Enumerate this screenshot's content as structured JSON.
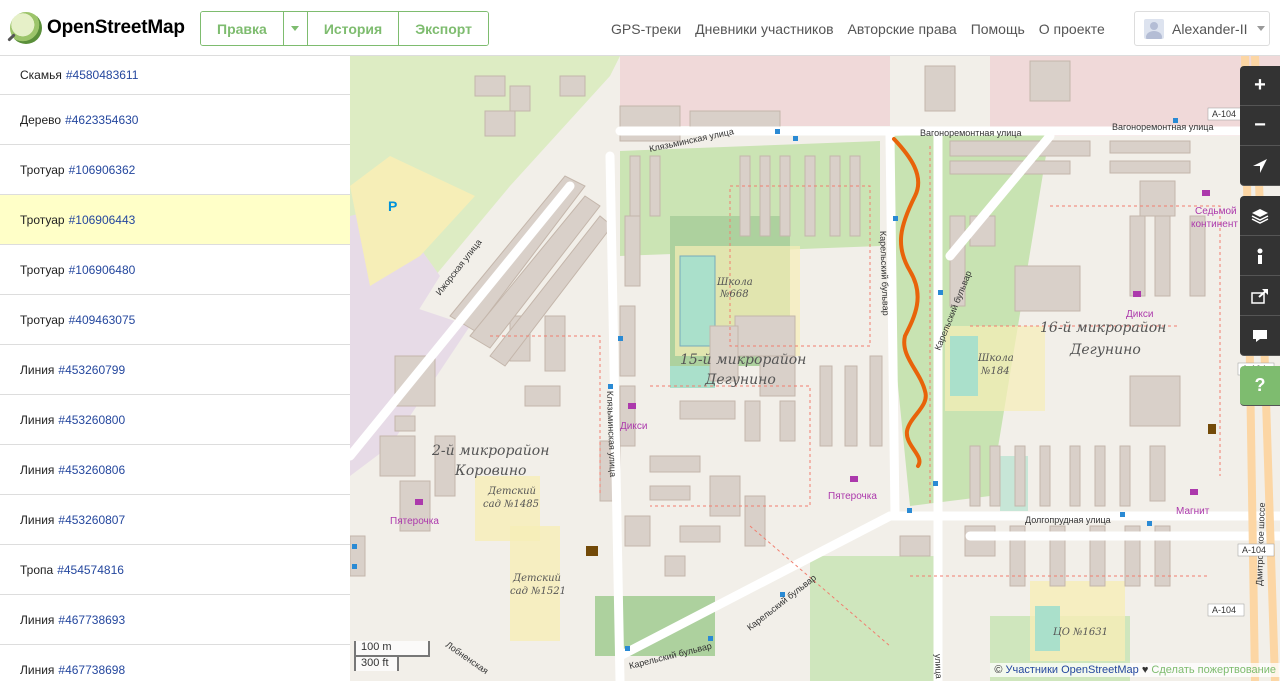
{
  "header": {
    "logo_text": "OpenStreetMap",
    "edit_label": "Правка",
    "history_label": "История",
    "export_label": "Экспорт",
    "nav": [
      "GPS-треки",
      "Дневники участников",
      "Авторские права",
      "Помощь",
      "О проекте"
    ],
    "username": "Alexander-II"
  },
  "sidebar": {
    "items": [
      {
        "type": "Скамья",
        "id": "#4580483611"
      },
      {
        "type": "Дерево",
        "id": "#4623354630"
      },
      {
        "type": "Тротуар",
        "id": "#106906362"
      },
      {
        "type": "Тротуар",
        "id": "#106906443",
        "selected": true
      },
      {
        "type": "Тротуар",
        "id": "#106906480"
      },
      {
        "type": "Тротуар",
        "id": "#409463075"
      },
      {
        "type": "Линия",
        "id": "#453260799"
      },
      {
        "type": "Линия",
        "id": "#453260800"
      },
      {
        "type": "Линия",
        "id": "#453260806"
      },
      {
        "type": "Линия",
        "id": "#453260807"
      },
      {
        "type": "Тропа",
        "id": "#454574816"
      },
      {
        "type": "Линия",
        "id": "#467738693"
      },
      {
        "type": "Линия",
        "id": "#467738698"
      }
    ]
  },
  "map": {
    "labels": {
      "district_15_a": "15-й микрорайон",
      "district_15_b": "Дегунино",
      "district_16_a": "16-й микрорайон",
      "district_16_b": "Дегунино",
      "district_2_a": "2-й микрорайон",
      "district_2_b": "Коровино",
      "school_668_a": "Школа",
      "school_668_b": "№668",
      "school_184_a": "Школа",
      "school_184_b": "№184",
      "kinder_1485_a": "Детский",
      "kinder_1485_b": "сад №1485",
      "kinder_1521_a": "Детский",
      "kinder_1521_b": "сад №1521",
      "co_1631": "ЦО №1631",
      "street_klyazminskaya": "Клязьминская улица",
      "street_vagonoremontnaya_1": "Вагоноремонтная улица",
      "street_vagonoremontnaya_2": "Вагоноремонтная улица",
      "street_izhorskaya": "Ижорская улица",
      "street_karelsky_1": "Карельский бульвар",
      "street_karelsky_2": "Карельский бульвар",
      "street_karelsky_3": "Карельский бульвар",
      "street_karelsky_4": "Карельский бульвар",
      "street_klyazminskaya_v": "Клязьминская улица",
      "street_dolgoprudnaya": "Долгопрудная улица",
      "street_dmitrovskoe": "Дмитровское шоссе",
      "street_lobnenskaya": "Лобненская",
      "street_ulitsa": "улица",
      "shop_dixi_1": "Дикси",
      "shop_dixi_2": "Дикси",
      "shop_pyaterochka_1": "Пятерочка",
      "shop_pyaterochka_2": "Пятерочка",
      "shop_magnit": "Магнит",
      "shop_sedmoy_a": "Седьмой",
      "shop_sedmoy_b": "континент",
      "parking": "P",
      "ref_a104": "А-104"
    },
    "scale_m": "100 m",
    "scale_ft": "300 ft",
    "attribution_prefix": "©",
    "attribution_link": "Участники OpenStreetMap",
    "attribution_heart": "♥",
    "attribution_donate": "Сделать пожертвование"
  },
  "controls": {
    "zoom_in": "+",
    "zoom_out": "−",
    "help": "?"
  },
  "colors": {
    "brand_green": "#7ebc6f",
    "link_blue": "#24479e",
    "highlight_orange": "#e8630a",
    "selected_row": "#ffffc8"
  }
}
